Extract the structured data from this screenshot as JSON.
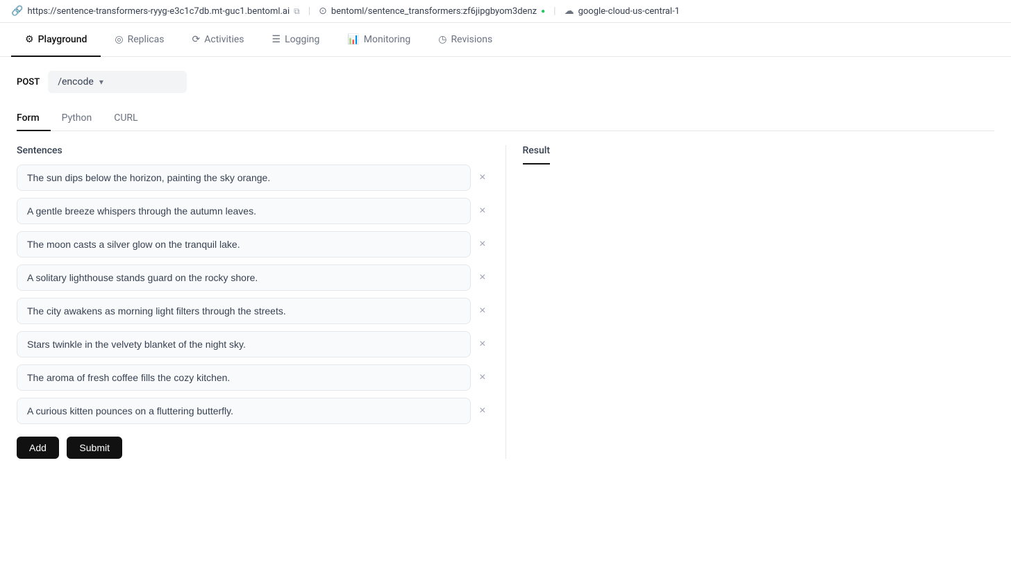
{
  "urlBar": {
    "endpoint": "https://sentence-transformers-ryyg-e3c1c7db.mt-guc1.bentoml.ai",
    "model": "bentoml/sentence_transformers:zf6jipgbyom3denz",
    "region": "google-cloud-us-central-1"
  },
  "navTabs": [
    {
      "id": "playground",
      "label": "Playground",
      "icon": "⚙",
      "active": true
    },
    {
      "id": "replicas",
      "label": "Replicas",
      "icon": "◎",
      "active": false
    },
    {
      "id": "activities",
      "label": "Activities",
      "icon": "⟳",
      "active": false
    },
    {
      "id": "logging",
      "label": "Logging",
      "icon": "☰",
      "active": false
    },
    {
      "id": "monitoring",
      "label": "Monitoring",
      "icon": "📊",
      "active": false
    },
    {
      "id": "revisions",
      "label": "Revisions",
      "icon": "◷",
      "active": false
    }
  ],
  "method": "POST",
  "endpoint": "/encode",
  "subTabs": [
    {
      "id": "form",
      "label": "Form",
      "active": true
    },
    {
      "id": "python",
      "label": "Python",
      "active": false
    },
    {
      "id": "curl",
      "label": "CURL",
      "active": false
    }
  ],
  "sentencesLabel": "Sentences",
  "sentences": [
    "The sun dips below the horizon, painting the sky orange.",
    "A gentle breeze whispers through the autumn leaves.",
    "The moon casts a silver glow on the tranquil lake.",
    "A solitary lighthouse stands guard on the rocky shore.",
    "The city awakens as morning light filters through the streets.",
    "Stars twinkle in the velvety blanket of the night sky.",
    "The aroma of fresh coffee fills the cozy kitchen.",
    "A curious kitten pounces on a fluttering butterfly."
  ],
  "buttons": {
    "add": "Add",
    "submit": "Submit"
  },
  "result": {
    "label": "Result"
  }
}
